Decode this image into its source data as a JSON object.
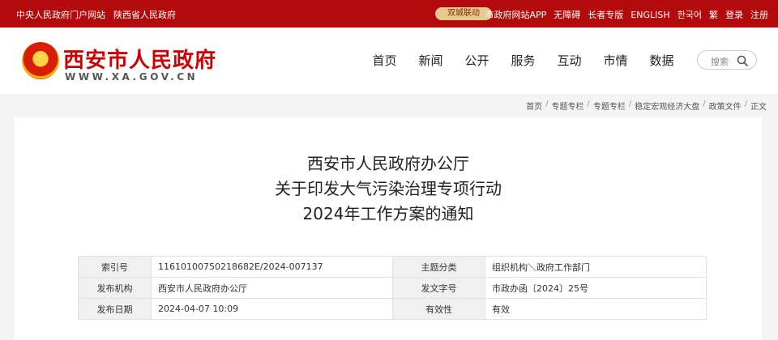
{
  "topbar": {
    "left_links": [
      "中央人民政府门户网站",
      "陕西省人民政府"
    ],
    "pill": "双城联动",
    "right_links": [
      "市政府网站APP",
      "无障碍",
      "长者专版",
      "ENGLISH",
      "한국어",
      "繁",
      "登录",
      "注册"
    ]
  },
  "header": {
    "site_title": "西安市人民政府",
    "site_url": "WWW.XA.GOV.CN",
    "nav": [
      "首页",
      "新闻",
      "公开",
      "服务",
      "互动",
      "市情",
      "数据"
    ],
    "search_placeholder": "搜索"
  },
  "breadcrumb": [
    "首页",
    "专题专栏",
    "专题专栏",
    "稳定宏观经济大盘",
    "政策文件",
    "正文"
  ],
  "article": {
    "title_lines": [
      "西安市人民政府办公厅",
      "关于印发大气污染治理专项行动",
      "2024年工作方案的通知"
    ]
  },
  "meta": {
    "rows": [
      {
        "k1": "索引号",
        "v1": "11610100750218682E/2024-007137",
        "k2": "主题分类",
        "v2": "组织机构＼政府工作部门"
      },
      {
        "k1": "发布机构",
        "v1": "西安市人民政府办公厅",
        "k2": "发文字号",
        "v2": "市政办函〔2024〕25号"
      },
      {
        "k1": "发布日期",
        "v1": "2024-04-07 10:09",
        "k2": "有效性",
        "v2": "有效"
      }
    ]
  },
  "colors": {
    "brand_red": "#b30b0b",
    "pill_bg": "#e8c98f"
  }
}
